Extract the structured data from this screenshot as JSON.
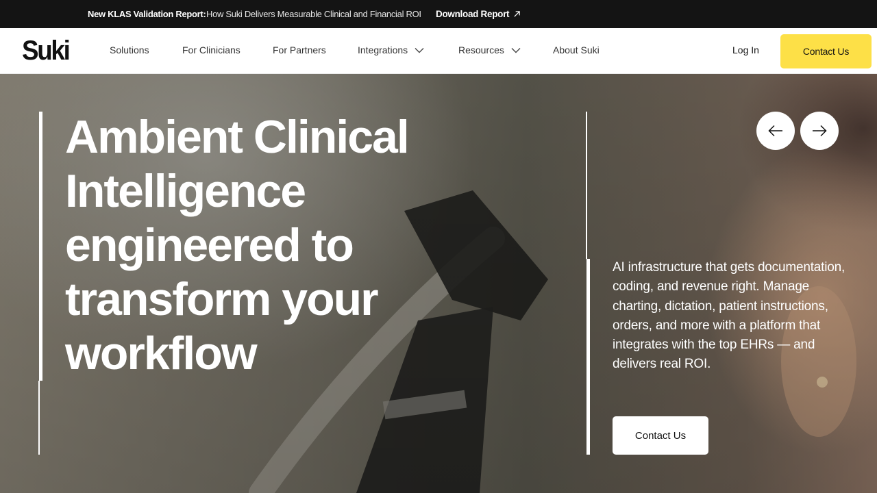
{
  "announcement": {
    "lead": "New KLAS Validation Report:",
    "message": "How Suki Delivers Measurable Clinical and Financial ROI",
    "link_label": "Download Report",
    "link_icon": "arrow-up-right-icon"
  },
  "nav": {
    "logo": "Suki",
    "items": [
      {
        "label": "Solutions"
      },
      {
        "label": "For Clinicians"
      },
      {
        "label": "For Partners"
      },
      {
        "label": "Integrations",
        "icon": "chevron-down-icon"
      },
      {
        "label": "Resources",
        "icon": "chevron-down-icon"
      },
      {
        "label": "About Suki"
      }
    ],
    "login": "Log In",
    "cta": "Contact Us",
    "cta_color": "#fde047"
  },
  "hero": {
    "headline": "Ambient Clinical Intelligence engineered to transform your workflow",
    "description": "AI infrastructure that gets documentation, coding, and revenue right. Manage charting, dictation, patient instructions, orders, and more with a platform that integrates with the top EHRs — and delivers real ROI.",
    "cta": "Contact Us",
    "prev_icon": "arrow-left-icon",
    "next_icon": "arrow-right-icon"
  }
}
